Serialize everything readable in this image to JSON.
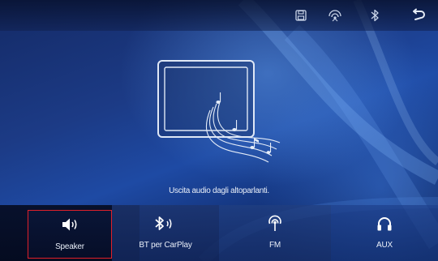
{
  "topbar": {
    "icons": [
      "save-icon",
      "radio-signal-icon",
      "bluetooth-icon",
      "back-icon"
    ]
  },
  "illustration": {
    "description_icons": [
      "tablet-screen-icon",
      "music-notes-icon"
    ]
  },
  "message": "Uscita audio dagli altoparlanti.",
  "sources": [
    {
      "label": "Speaker",
      "icon": "speaker-icon",
      "selected": true
    },
    {
      "label": "BT per CarPlay",
      "icon": "bluetooth-audio-icon",
      "selected": false
    },
    {
      "label": "FM",
      "icon": "fm-radio-icon",
      "selected": false
    },
    {
      "label": "AUX",
      "icon": "headphones-icon",
      "selected": false
    }
  ],
  "colors": {
    "selection_border": "#e0202a",
    "background": "#1c3b86",
    "text": "#e8eef8"
  }
}
